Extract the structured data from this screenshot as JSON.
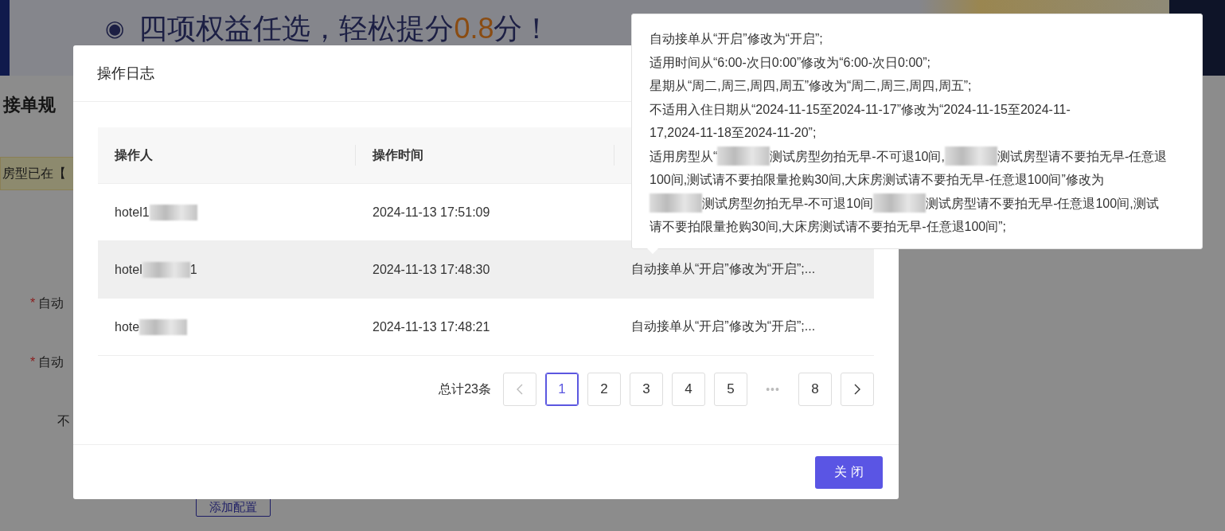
{
  "banner": {
    "icon": "◉",
    "text_before": "四项权益任选，轻松提分",
    "highlight": "0.8",
    "text_after": "分！"
  },
  "page": {
    "heading": "接单规",
    "notice": "房型已在【",
    "fields": [
      {
        "required_mark": "*",
        "label": "自动"
      },
      {
        "required_mark": "*",
        "label": "自动"
      },
      {
        "label": "不"
      }
    ],
    "add_button": "添加配置"
  },
  "dialog": {
    "title": "操作日志",
    "table": {
      "columns": [
        "操作人",
        "操作时间"
      ],
      "rows": [
        {
          "hovered": false,
          "operator": [
            {
              "kind": "text",
              "text": "hotel1"
            },
            {
              "kind": "redacted"
            }
          ],
          "time": "2024-11-13 17:51:09",
          "change": ""
        },
        {
          "hovered": true,
          "operator": [
            {
              "kind": "text",
              "text": "hotel"
            },
            {
              "kind": "redacted"
            },
            {
              "kind": "text",
              "text": "1"
            }
          ],
          "time": "2024-11-13 17:48:30",
          "change": "自动接单从“开启”修改为“开启”;..."
        },
        {
          "hovered": false,
          "operator": [
            {
              "kind": "text",
              "text": "hote"
            },
            {
              "kind": "redacted"
            }
          ],
          "time": "2024-11-13 17:48:21",
          "change": "自动接单从“开启”修改为“开启”;..."
        }
      ]
    },
    "pagination": {
      "total": "总计23条",
      "prev_disabled": true,
      "next_disabled": false,
      "items": [
        {
          "kind": "page",
          "label": "1",
          "selected": true
        },
        {
          "kind": "page",
          "label": "2",
          "selected": false
        },
        {
          "kind": "page",
          "label": "3",
          "selected": false
        },
        {
          "kind": "page",
          "label": "4",
          "selected": false
        },
        {
          "kind": "page",
          "label": "5",
          "selected": false
        },
        {
          "kind": "ellipsis",
          "label": "•••"
        },
        {
          "kind": "page",
          "label": "8",
          "selected": false
        }
      ]
    },
    "close_button": "关 闭"
  },
  "tooltip": {
    "lines": [
      [
        {
          "kind": "text",
          "text": "自动接单从“开启”修改为“开启”;"
        }
      ],
      [
        {
          "kind": "text",
          "text": "适用时间从“6:00-次日0:00”修改为“6:00-次日0:00”;"
        }
      ],
      [
        {
          "kind": "text",
          "text": "星期从“周二,周三,周四,周五”修改为“周二,周三,周四,周五”;"
        }
      ],
      [
        {
          "kind": "text",
          "text": "不适用入住日期从“2024-11-15至2024-11-17”修改为“2024-11-15至2024-11-"
        }
      ],
      [
        {
          "kind": "text",
          "text": "17,2024-11-18至2024-11-20”;"
        }
      ],
      [
        {
          "kind": "text",
          "text": "适用房型从“"
        },
        {
          "kind": "redacted"
        },
        {
          "kind": "text",
          "text": "测试房型勿拍无早-不可退10间,"
        },
        {
          "kind": "redacted"
        },
        {
          "kind": "text",
          "text": "测试房型请不要拍无早-任意退"
        }
      ],
      [
        {
          "kind": "text",
          "text": "100间,测试请不要拍限量抢购30间,大床房测试请不要拍无早-任意退100间”修改为"
        }
      ],
      [
        {
          "kind": "redacted"
        },
        {
          "kind": "text",
          "text": "测试房型勿拍无早-不可退10间"
        },
        {
          "kind": "redacted"
        },
        {
          "kind": "text",
          "text": "测试房型请不要拍无早-任意退100间,测试"
        }
      ],
      [
        {
          "kind": "text",
          "text": "请不要拍限量抢购30间,大床房测试请不要拍无早-任意退100间”;"
        }
      ]
    ]
  }
}
